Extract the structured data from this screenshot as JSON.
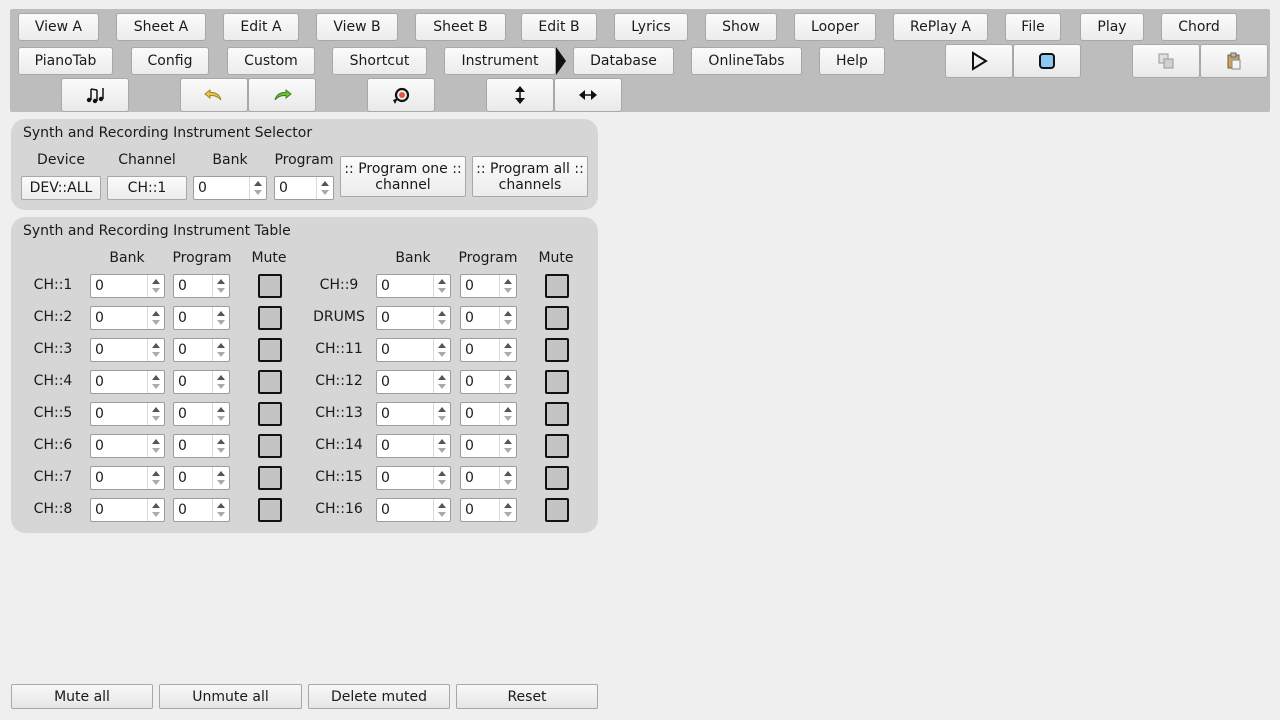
{
  "toolbar": {
    "row1": [
      "View A",
      "Sheet A",
      "Edit A",
      "View B",
      "Sheet B",
      "Edit B",
      "Lyrics",
      "Show",
      "Looper",
      "RePlay A",
      "File",
      "Play",
      "Chord"
    ],
    "row2": [
      "PianoTab",
      "Config",
      "Custom",
      "Shortcut",
      "Instrument",
      "Database",
      "OnlineTabs",
      "Help"
    ]
  },
  "selector": {
    "title": "Synth and Recording Instrument Selector",
    "col_device": "Device",
    "col_channel": "Channel",
    "col_bank": "Bank",
    "col_program": "Program",
    "device_value": "DEV::ALL",
    "channel_value": "CH::1",
    "bank_value": "0",
    "program_value": "0",
    "program_one": ":: Program one :: channel",
    "program_all": ":: Program all :: channels"
  },
  "table": {
    "title": "Synth and Recording Instrument Table",
    "col_bank": "Bank",
    "col_program": "Program",
    "col_mute": "Mute",
    "left": [
      {
        "ch": "CH::1",
        "bank": "0",
        "program": "0"
      },
      {
        "ch": "CH::2",
        "bank": "0",
        "program": "0"
      },
      {
        "ch": "CH::3",
        "bank": "0",
        "program": "0"
      },
      {
        "ch": "CH::4",
        "bank": "0",
        "program": "0"
      },
      {
        "ch": "CH::5",
        "bank": "0",
        "program": "0"
      },
      {
        "ch": "CH::6",
        "bank": "0",
        "program": "0"
      },
      {
        "ch": "CH::7",
        "bank": "0",
        "program": "0"
      },
      {
        "ch": "CH::8",
        "bank": "0",
        "program": "0"
      }
    ],
    "right": [
      {
        "ch": "CH::9",
        "bank": "0",
        "program": "0"
      },
      {
        "ch": "DRUMS",
        "bank": "0",
        "program": "0"
      },
      {
        "ch": "CH::11",
        "bank": "0",
        "program": "0"
      },
      {
        "ch": "CH::12",
        "bank": "0",
        "program": "0"
      },
      {
        "ch": "CH::13",
        "bank": "0",
        "program": "0"
      },
      {
        "ch": "CH::14",
        "bank": "0",
        "program": "0"
      },
      {
        "ch": "CH::15",
        "bank": "0",
        "program": "0"
      },
      {
        "ch": "CH::16",
        "bank": "0",
        "program": "0"
      }
    ]
  },
  "bottom": {
    "mute_all": "Mute all",
    "unmute_all": "Unmute all",
    "delete_muted": "Delete muted",
    "reset": "Reset"
  },
  "icons": {
    "play": "play-icon",
    "stop": "stop-icon",
    "copy": "copy-icon",
    "paste": "paste-icon",
    "notes": "music-notes-icon",
    "undo": "undo-icon",
    "redo": "redo-icon",
    "refresh": "refresh-icon",
    "vertical_resize": "vertical-resize-icon",
    "horizontal_resize": "horizontal-resize-icon"
  },
  "colors": {
    "toolbar_bg": "#bdbdbd",
    "panel_bg": "#d6d6d6",
    "undo_yellow": "#e6c84a",
    "redo_green": "#6cbf3c",
    "stop_fill": "#8ec8f0"
  }
}
